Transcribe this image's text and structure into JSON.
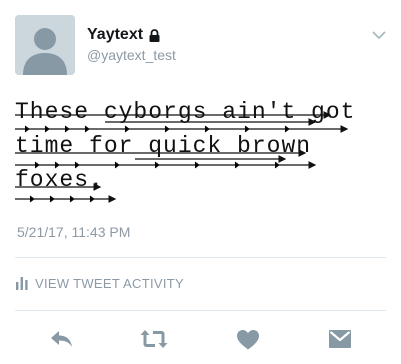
{
  "user": {
    "display_name": "Yaytext",
    "username": "@yaytext_test"
  },
  "tweet": {
    "lines": [
      "These cyborgs ain't got",
      "time for quick brown",
      "foxes."
    ],
    "timestamp": "5/21/17, 11:43 PM"
  },
  "activity": {
    "label": "VIEW TWEET ACTIVITY"
  },
  "icons": {
    "lock": "lock-icon",
    "caret": "chevron-down-icon",
    "activity": "bar-chart-icon",
    "reply": "reply-icon",
    "retweet": "retweet-icon",
    "like": "heart-icon",
    "message": "direct-message-icon"
  },
  "colors": {
    "icon_gray": "#8899a6",
    "text": "#14171a",
    "secondary": "#8c9aa6",
    "divider": "#e1e8ed"
  }
}
